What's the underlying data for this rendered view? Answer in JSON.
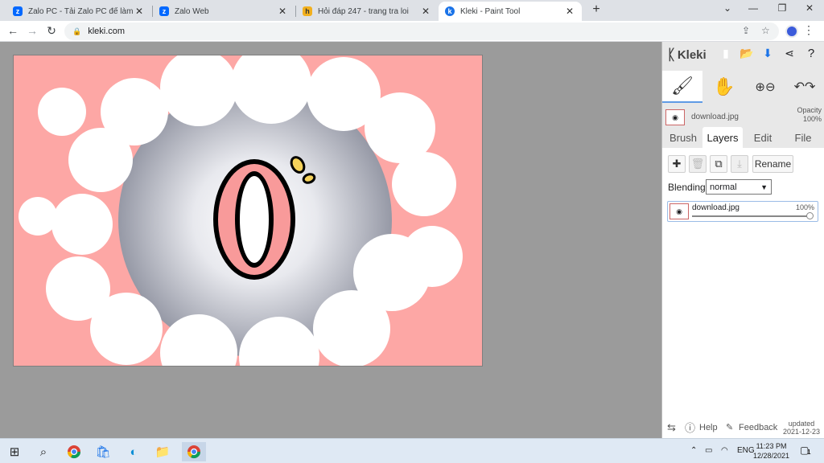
{
  "browser": {
    "tabs": [
      {
        "title": "Zalo PC - Tải Zalo PC để làm việc",
        "icon": "zalo-icon",
        "active": false
      },
      {
        "title": "Zalo Web",
        "icon": "zalo-icon",
        "active": false
      },
      {
        "title": "Hỏi đáp 247 - trang tra loi",
        "icon": "hoidap-icon",
        "active": false
      },
      {
        "title": "Kleki - Paint Tool",
        "icon": "kleki-icon",
        "active": true
      }
    ],
    "close_glyph": "✕",
    "new_tab_glyph": "+",
    "url": "kleki.com",
    "window_controls": {
      "minimize": "⌄",
      "min": "—",
      "max": "❐",
      "close": "✕"
    }
  },
  "kleki": {
    "logo": "Kleki",
    "tools": [
      "brush-tool",
      "hand-tool",
      "zoom-tool",
      "undo-redo-tool"
    ],
    "current_file": "download.jpg",
    "opacity_label": "Opacity",
    "opacity_value": "100%",
    "tabs": [
      "Brush",
      "Layers",
      "Edit",
      "File"
    ],
    "active_tab": "Layers",
    "rename_label": "Rename",
    "blending_label": "Blending",
    "blending_value": "normal",
    "layers": [
      {
        "name": "download.jpg",
        "opacity": "100%"
      }
    ],
    "footer": {
      "help": "Help",
      "feedback": "Feedback",
      "updated_label": "updated",
      "updated_date": "2021-12-23"
    }
  },
  "taskbar": {
    "apps": [
      "windows-start-icon",
      "search-icon",
      "chrome-icon",
      "store-icon",
      "edge-icon",
      "explorer-icon",
      "chrome-icon"
    ],
    "lang": "ENG",
    "time": "11:23 PM",
    "date": "12/28/2021",
    "notifications": "1"
  },
  "colors": {
    "canvas_bg": "#fda7a5",
    "accent_blue": "#1a73e8",
    "panel_bg": "#e8e8e8",
    "workspace_bg": "#9b9b9b"
  }
}
